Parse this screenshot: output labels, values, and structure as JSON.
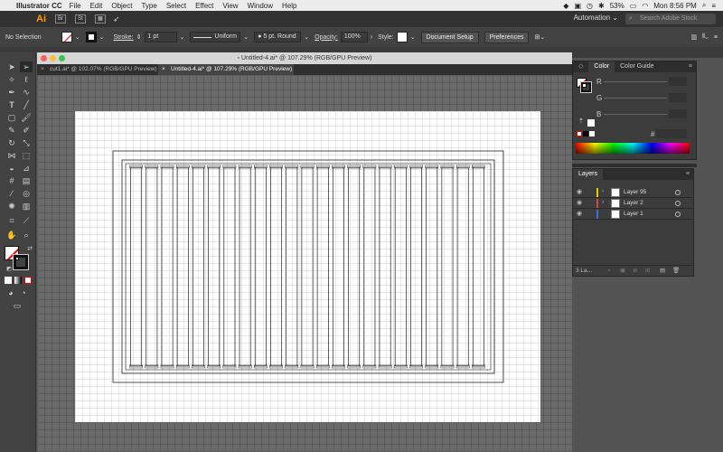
{
  "menubar": {
    "app_name": "Illustrator CC",
    "items": [
      "File",
      "Edit",
      "Object",
      "Type",
      "Select",
      "Effect",
      "View",
      "Window",
      "Help"
    ],
    "battery": "53%",
    "clock": "Mon 8:56 PM"
  },
  "appbar": {
    "logo": "Ai",
    "bridge_label": "Br",
    "stock_label": "St",
    "workspace": "Automation",
    "search_placeholder": "Search Adobe Stock"
  },
  "control_bar": {
    "selection": "No Selection",
    "stroke_label": "Stroke:",
    "stroke_weight": "1 pt",
    "profile": "Uniform",
    "brush": "5 pt. Round",
    "opacity_label": "Opacity:",
    "opacity": "100%",
    "style_label": "Style:",
    "document_setup": "Document Setup",
    "preferences": "Preferences"
  },
  "document": {
    "window_title": "Untitled-4.ai* @ 107.29% (RGB/GPU Preview)",
    "tabs": [
      {
        "label": "cut1.ai* @ 102.07% (RGB/GPU Preview)",
        "active": false
      },
      {
        "label": "Untitled-4.ai* @ 107.29% (RGB/GPU Preview)",
        "active": true
      }
    ]
  },
  "color_panel": {
    "tabs": [
      "Color",
      "Color Guide"
    ],
    "channels": [
      "R",
      "G",
      "B"
    ],
    "hex_symbol": "#"
  },
  "layers_panel": {
    "title": "Layers",
    "layers": [
      {
        "name": "Layer 95",
        "color": "#e0d000",
        "expandable": true
      },
      {
        "name": "Layer 2",
        "color": "#e04040",
        "expandable": true
      },
      {
        "name": "Layer 1",
        "color": "#3a6fe0",
        "expandable": false
      }
    ],
    "count_label": "3 La..."
  },
  "tools": [
    "selection-tool",
    "direct-selection-tool",
    "magic-wand-tool",
    "lasso-tool",
    "pen-tool",
    "curvature-tool",
    "type-tool",
    "line-tool",
    "rectangle-tool",
    "paintbrush-tool",
    "shaper-tool",
    "pencil-tool",
    "rotate-tool",
    "scale-tool",
    "width-tool",
    "free-transform-tool",
    "shape-builder-tool",
    "perspective-tool",
    "mesh-tool",
    "gradient-tool",
    "eyedropper-tool",
    "blend-tool",
    "symbol-sprayer-tool",
    "graph-tool",
    "artboard-tool",
    "slice-tool",
    "hand-tool",
    "zoom-tool"
  ]
}
